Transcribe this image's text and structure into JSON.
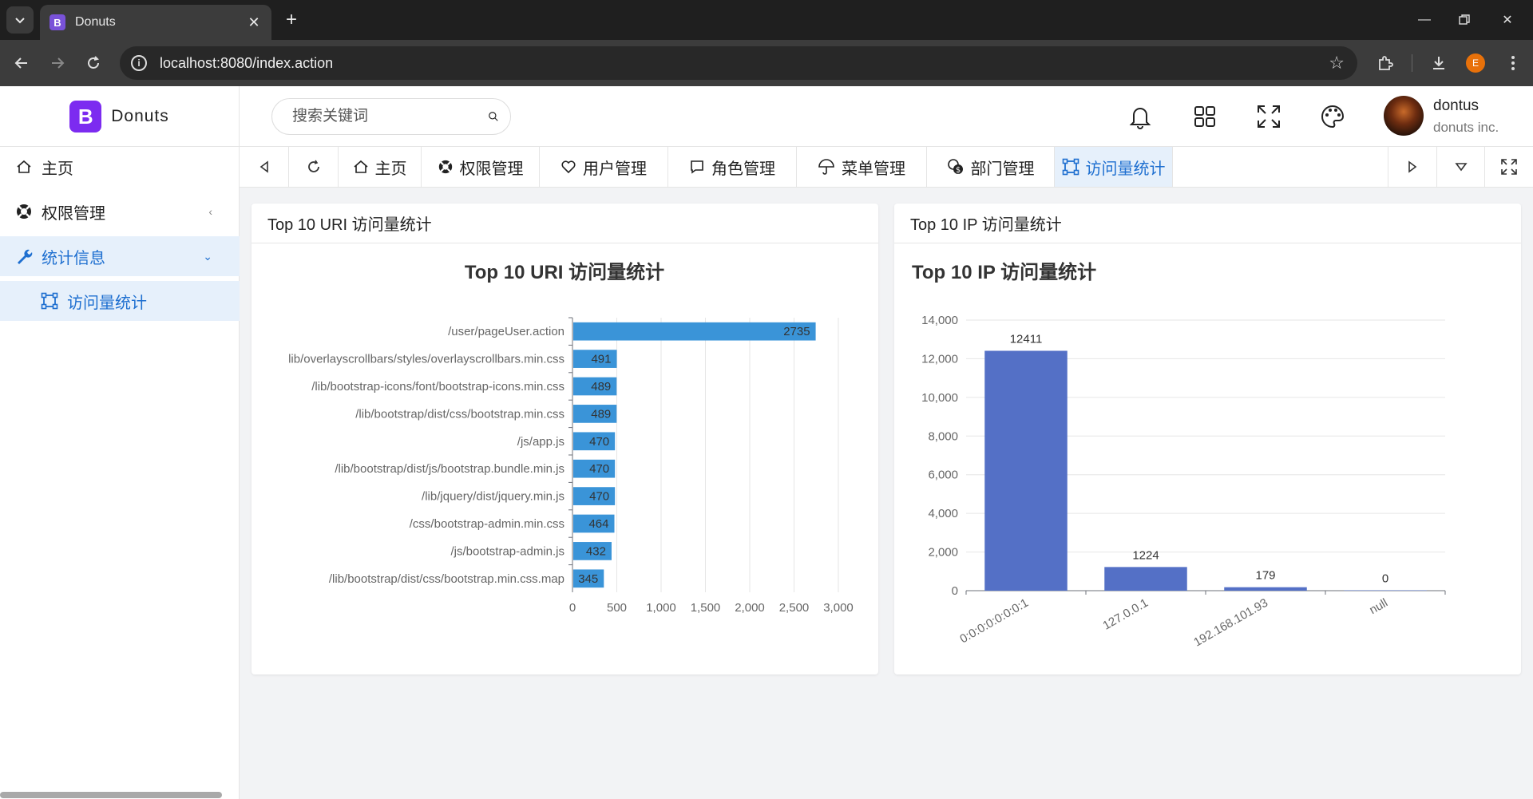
{
  "browser": {
    "tab_title": "Donuts",
    "favicon_letter": "B",
    "url": "localhost:8080/index.action",
    "profile_letter": "E"
  },
  "header": {
    "brand_letter": "B",
    "brand_name": "Donuts",
    "search_placeholder": "搜索关键词",
    "user_name": "dontus",
    "user_org": "donuts inc."
  },
  "sidebar": {
    "items": [
      {
        "label": "主页"
      },
      {
        "label": "权限管理"
      },
      {
        "label": "统计信息"
      },
      {
        "label": "访问量统计"
      }
    ]
  },
  "tabs": [
    {
      "label": "主页"
    },
    {
      "label": "权限管理"
    },
    {
      "label": "用户管理"
    },
    {
      "label": "角色管理"
    },
    {
      "label": "菜单管理"
    },
    {
      "label": "部门管理"
    },
    {
      "label": "访问量统计"
    }
  ],
  "cards": {
    "uri_title": "Top 10 URI 访问量统计",
    "ip_title": "Top 10 IP 访问量统计"
  },
  "colors": {
    "uri_bar": "#3a94d8",
    "ip_bar": "#5470c6",
    "accent": "#1e6fd0"
  },
  "chart_data": [
    {
      "type": "bar",
      "orientation": "horizontal",
      "title": "Top 10 URI 访问量统计",
      "categories": [
        "/user/pageUser.action",
        "lib/overlayscrollbars/styles/overlayscrollbars.min.css",
        "/lib/bootstrap-icons/font/bootstrap-icons.min.css",
        "/lib/bootstrap/dist/css/bootstrap.min.css",
        "/js/app.js",
        "/lib/bootstrap/dist/js/bootstrap.bundle.min.js",
        "/lib/jquery/dist/jquery.min.js",
        "/css/bootstrap-admin.min.css",
        "/js/bootstrap-admin.js",
        "/lib/bootstrap/dist/css/bootstrap.min.css.map"
      ],
      "values": [
        2735,
        491,
        489,
        489,
        470,
        470,
        470,
        464,
        432,
        345
      ],
      "xlim": [
        0,
        3000
      ],
      "xticks": [
        "0",
        "500",
        "1,000",
        "1,500",
        "2,000",
        "2,500",
        "3,000"
      ],
      "grid": true
    },
    {
      "type": "bar",
      "title": "Top 10 IP 访问量统计",
      "categories": [
        "0:0:0:0:0:0:0:1",
        "127.0.0.1",
        "192.168.101.93",
        "null"
      ],
      "values": [
        12411,
        1224,
        179,
        0
      ],
      "ylim": [
        0,
        14000
      ],
      "yticks": [
        "0",
        "2,000",
        "4,000",
        "6,000",
        "8,000",
        "10,000",
        "12,000",
        "14,000"
      ],
      "grid": true
    }
  ]
}
